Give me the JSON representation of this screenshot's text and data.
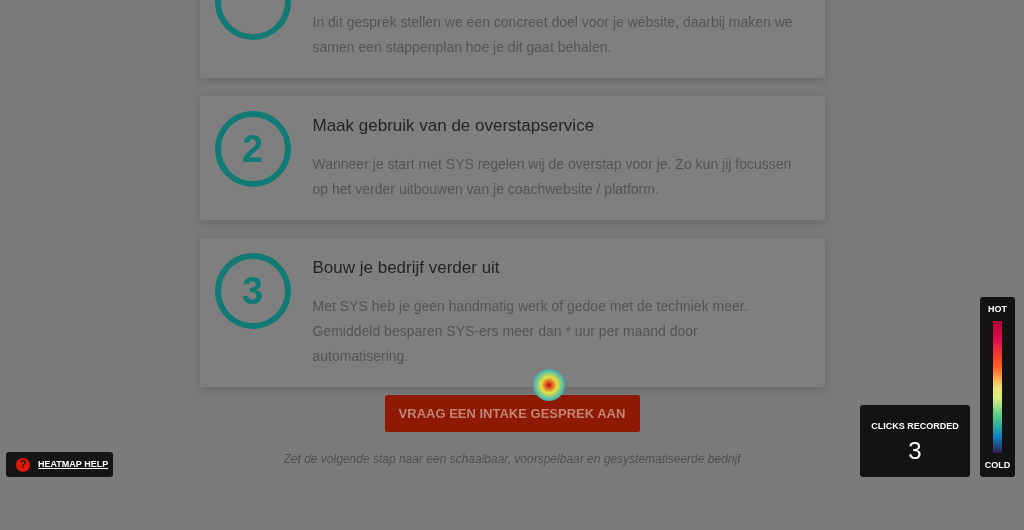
{
  "steps": [
    {
      "body": "In dit gesprek stellen we een concreet doel voor je website, daarbij maken we samen een stappenplan hoe je dit gaat behalen."
    },
    {
      "number": "2",
      "title": "Maak gebruik van de overstapservice",
      "body": "Wanneer je start met SYS regelen wij de overstap voor je. Zo kun jij focussen op het verder uitbouwen van je coachwebsite / platform."
    },
    {
      "number": "3",
      "title": "Bouw je bedrijf verder uit",
      "body": "Met SYS heb je geen handmatig werk of gedoe met de techniek meer. Gemiddeld besparen SYS-ers meer dan * uur per maand door automatisering."
    }
  ],
  "cta": {
    "label": "VRAAG EEN INTAKE GESPREK AAN"
  },
  "tagline": "Zet de volgende stap naar een schaalbaar, voorspelbaar en gesystematiseerde bedrijf",
  "help_button": {
    "icon": "?",
    "label": "HEATMAP HELP"
  },
  "clicks": {
    "label": "CLICKS RECORDED",
    "count": "3"
  },
  "legend": {
    "top": "HOT",
    "bottom": "COLD"
  }
}
